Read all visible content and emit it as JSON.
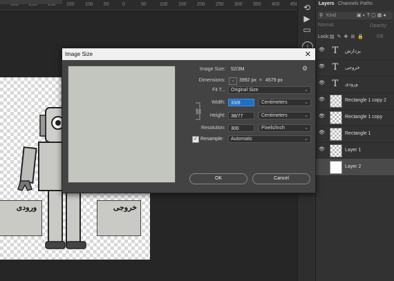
{
  "ruler": {
    "ticks": [
      "300",
      "250",
      "200",
      "150",
      "100",
      "50",
      "0",
      "50",
      "100",
      "150",
      "200",
      "250",
      "300",
      "350",
      "400",
      "450"
    ]
  },
  "canvas_labels": {
    "left_box": "ورودی",
    "right_box": "خروجی"
  },
  "panel": {
    "tabs": [
      "Layers",
      "Channels",
      "Paths"
    ],
    "search_placeholder": "Kind",
    "blend_mode": "Normal",
    "opacity_label": "Opacity:",
    "lock_label": "Lock:",
    "fill_label": "Fill:",
    "layers": [
      {
        "name": "پردازش",
        "kind": "text"
      },
      {
        "name": "خروجی",
        "kind": "text"
      },
      {
        "name": "ورودی",
        "kind": "text"
      },
      {
        "name": "Rectangle 1 copy 2",
        "kind": "shape"
      },
      {
        "name": "Rectangle 1 copy",
        "kind": "shape"
      },
      {
        "name": "Rectangle 1",
        "kind": "shape"
      },
      {
        "name": "Layer 1",
        "kind": "image"
      },
      {
        "name": "Layer 2",
        "kind": "fill",
        "selected": true
      }
    ]
  },
  "dialog": {
    "title": "Image Size",
    "image_size_label": "Image Size:",
    "image_size_value": "52/3M",
    "dimensions_label": "Dimensions:",
    "dim_width": "3992 px",
    "dim_sep": "×",
    "dim_height": "4579 px",
    "fit_label": "Fit T...",
    "fit_value": "Original Size",
    "width_label": "Width:",
    "width_value": "33/8",
    "width_unit": "Centimeters",
    "height_label": "Height:",
    "height_value": "38/77",
    "height_unit": "Centimeters",
    "resolution_label": "Resolution:",
    "resolution_value": "300",
    "resolution_unit": "Pixels/Inch",
    "resample_label": "Resample:",
    "resample_checked": true,
    "resample_value": "Automatic",
    "ok_label": "OK",
    "cancel_label": "Cancel"
  }
}
